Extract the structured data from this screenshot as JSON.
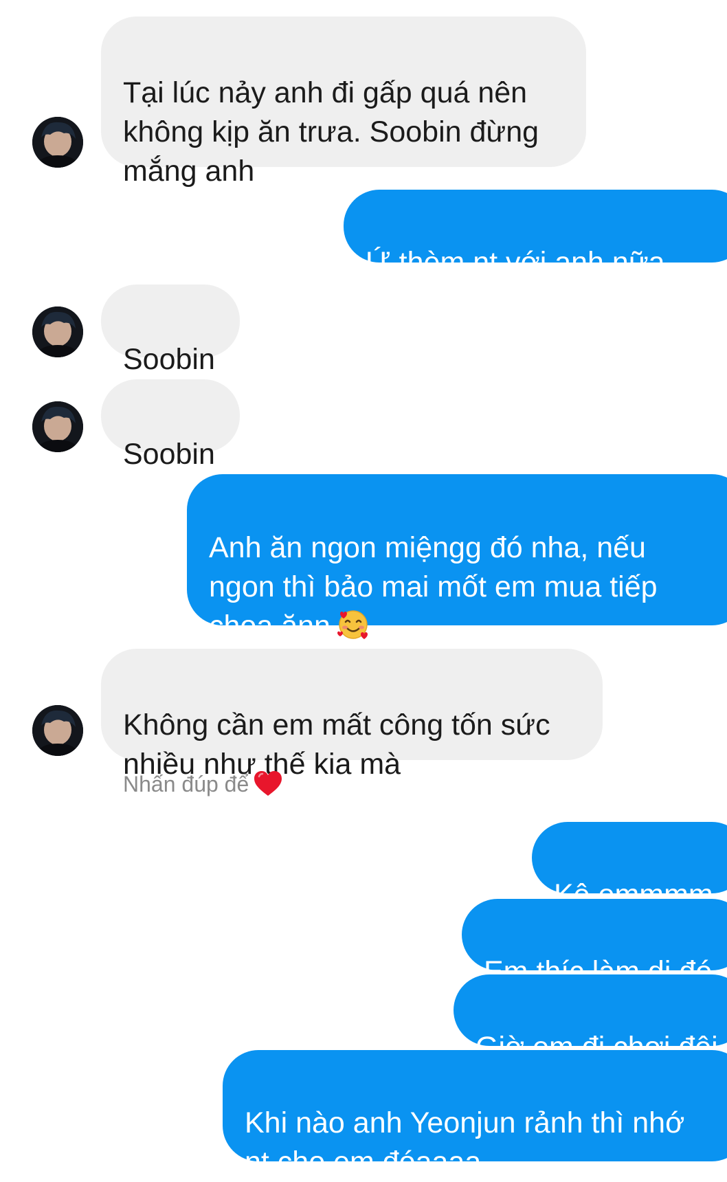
{
  "messages": [
    {
      "sender": "other",
      "text": "Tại lúc nảy anh đi gấp quá nên\nkhông kịp ăn trưa. Soobin đừng\nmắng anh"
    },
    {
      "sender": "me",
      "text": "Ứ thèm nt với anh nữa"
    },
    {
      "sender": "other",
      "text": "Soobin"
    },
    {
      "sender": "other",
      "text": "Soobin"
    },
    {
      "sender": "me",
      "text": "Anh ăn ngon miệngg đó nha, nếu\nngon thì bảo mai mốt em mua tiếp\nchoa ănn",
      "emoji": "smiling-face-with-hearts"
    },
    {
      "sender": "other",
      "text": "Không cần em mất công tốn sức\nnhiều như thế kia mà"
    },
    {
      "sender": "me",
      "text": "Kệ emmmm"
    },
    {
      "sender": "me",
      "text": "Em thíc làm dị đó"
    },
    {
      "sender": "me",
      "text": "Giờ em đi chơi đêi"
    },
    {
      "sender": "me",
      "text": "Khi nào anh Yeonjun rảnh thì nhớ\nnt cho em đóaaaa"
    }
  ],
  "double_tap_hint": {
    "text": "Nhấn đúp để",
    "icon": "red-heart-icon"
  },
  "colors": {
    "outgoing_bubble": "#0a93f1",
    "incoming_bubble": "#efefef",
    "hint_text": "#8a8a8a",
    "heart": "#e8162c"
  }
}
